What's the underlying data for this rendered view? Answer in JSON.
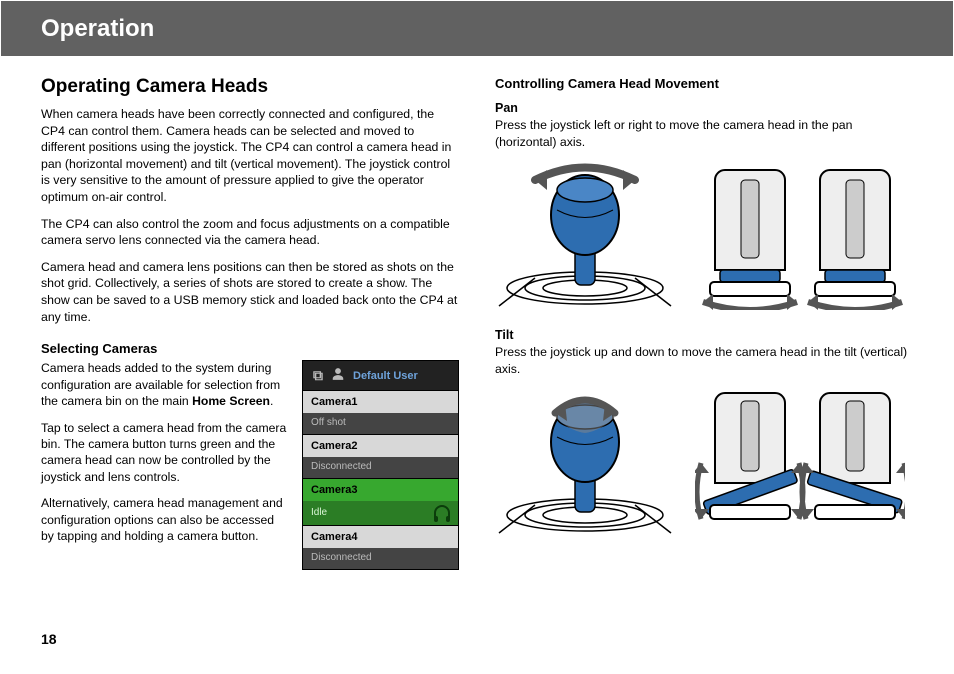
{
  "header": {
    "title": "Operation"
  },
  "left": {
    "h2": "Operating Camera Heads",
    "p1": "When camera heads have been correctly connected and configured, the CP4 can control them. Camera heads can be selected and moved to different positions using the joystick. The CP4 can control a camera head in pan (horizontal movement) and tilt (vertical movement). The joystick control is very sensitive to the amount of pressure applied to give the operator optimum on-air control.",
    "p2": "The CP4 can also control the zoom and focus adjustments on a compatible camera servo lens connected via the camera head.",
    "p3": "Camera head and camera lens positions can then be stored as shots on the shot grid. Collectively, a series of shots are stored to create a show. The show can be saved to a USB memory stick and loaded back onto the CP4 at any time.",
    "sel_h3": "Selecting Cameras",
    "sel_p1a": "Camera heads added to the system during configuration are available for selection from the camera bin on the main ",
    "sel_p1b": "Home Screen",
    "sel_p1c": ".",
    "sel_p2": "Tap to select a camera head from the camera bin. The camera button turns green and the camera head can now be controlled by the joystick and lens controls.",
    "sel_p3": "Alternatively, camera head management and configuration options can also be accessed by tapping and holding a camera button."
  },
  "bin": {
    "user": "Default User",
    "items": [
      {
        "name": "Camera1",
        "status": "Off shot",
        "selected": false
      },
      {
        "name": "Camera2",
        "status": "Disconnected",
        "selected": false
      },
      {
        "name": "Camera3",
        "status": "Idle",
        "selected": true
      },
      {
        "name": "Camera4",
        "status": "Disconnected",
        "selected": false
      }
    ]
  },
  "right": {
    "h3": "Controlling Camera Head Movement",
    "pan_h": "Pan",
    "pan_p": "Press the joystick left or right to move the camera head in the pan (horizontal) axis.",
    "tilt_h": "Tilt",
    "tilt_p": "Press the joystick up and down to move the camera head in the tilt (vertical) axis."
  },
  "page_number": "18"
}
